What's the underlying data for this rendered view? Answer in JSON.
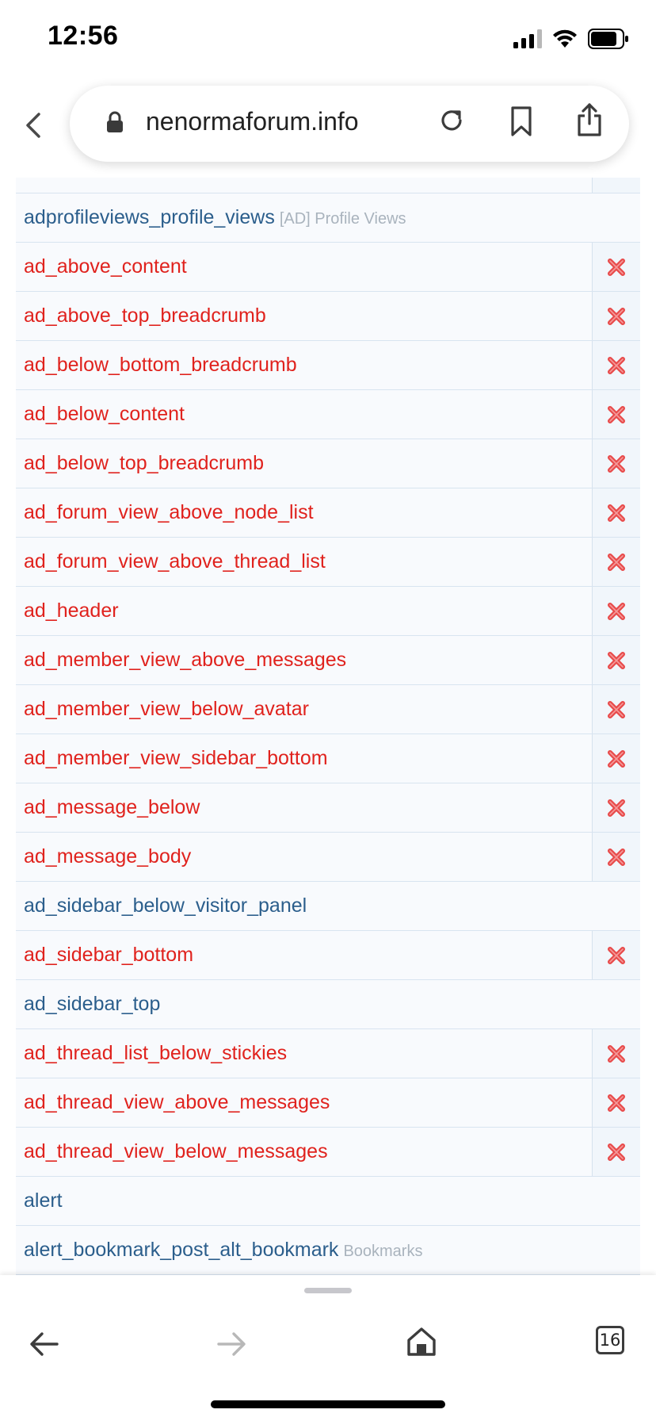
{
  "status_bar": {
    "time": "12:56",
    "icons": [
      "cellular-signal-icon",
      "wifi-icon",
      "battery-icon"
    ]
  },
  "browser": {
    "url": "nenormaforum.info",
    "icons": [
      "back-chevron-icon",
      "lock-icon",
      "reload-icon",
      "bookmark-icon",
      "share-icon"
    ]
  },
  "list": {
    "rows": [
      {
        "name": "adprofileviews_profile_views",
        "hint": "[AD] Profile Views",
        "state": "normal",
        "has_action": false
      },
      {
        "name": "ad_above_content",
        "hint": "",
        "state": "enabled",
        "has_action": true
      },
      {
        "name": "ad_above_top_breadcrumb",
        "hint": "",
        "state": "enabled",
        "has_action": true
      },
      {
        "name": "ad_below_bottom_breadcrumb",
        "hint": "",
        "state": "enabled",
        "has_action": true
      },
      {
        "name": "ad_below_content",
        "hint": "",
        "state": "enabled",
        "has_action": true
      },
      {
        "name": "ad_below_top_breadcrumb",
        "hint": "",
        "state": "enabled",
        "has_action": true
      },
      {
        "name": "ad_forum_view_above_node_list",
        "hint": "",
        "state": "enabled",
        "has_action": true
      },
      {
        "name": "ad_forum_view_above_thread_list",
        "hint": "",
        "state": "enabled",
        "has_action": true
      },
      {
        "name": "ad_header",
        "hint": "",
        "state": "enabled",
        "has_action": true
      },
      {
        "name": "ad_member_view_above_messages",
        "hint": "",
        "state": "enabled",
        "has_action": true
      },
      {
        "name": "ad_member_view_below_avatar",
        "hint": "",
        "state": "enabled",
        "has_action": true
      },
      {
        "name": "ad_member_view_sidebar_bottom",
        "hint": "",
        "state": "enabled",
        "has_action": true
      },
      {
        "name": "ad_message_below",
        "hint": "",
        "state": "enabled",
        "has_action": true
      },
      {
        "name": "ad_message_body",
        "hint": "",
        "state": "enabled",
        "has_action": true
      },
      {
        "name": "ad_sidebar_below_visitor_panel",
        "hint": "",
        "state": "normal",
        "has_action": false
      },
      {
        "name": "ad_sidebar_bottom",
        "hint": "",
        "state": "enabled",
        "has_action": true
      },
      {
        "name": "ad_sidebar_top",
        "hint": "",
        "state": "normal",
        "has_action": false
      },
      {
        "name": "ad_thread_list_below_stickies",
        "hint": "",
        "state": "enabled",
        "has_action": true
      },
      {
        "name": "ad_thread_view_above_messages",
        "hint": "",
        "state": "enabled",
        "has_action": true
      },
      {
        "name": "ad_thread_view_below_messages",
        "hint": "",
        "state": "enabled",
        "has_action": true
      },
      {
        "name": "alert",
        "hint": "",
        "state": "normal",
        "has_action": false
      },
      {
        "name": "alert_bookmark_post_alt_bookmark",
        "hint": "Bookmarks",
        "state": "normal",
        "has_action": false
      }
    ],
    "action_icon": "delete-x-icon"
  },
  "toolbar": {
    "tab_count": "16",
    "icons": [
      "back-arrow-icon",
      "forward-arrow-icon",
      "home-icon",
      "tabs-icon"
    ]
  },
  "colors": {
    "enabled_text": "#e0221d",
    "normal_text": "#2b5e8c",
    "hint_text": "#a9b3bd",
    "delete_icon": "#e84a4a"
  }
}
